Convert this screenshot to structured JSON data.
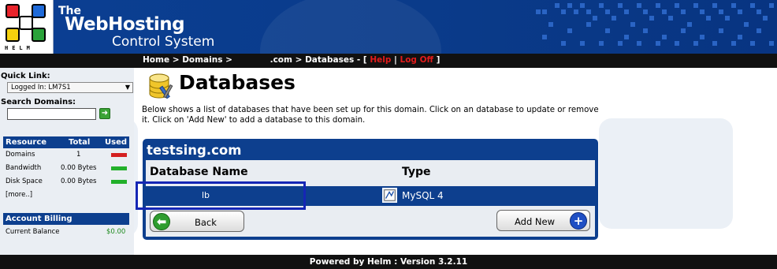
{
  "header": {
    "logo_text": "HELM",
    "brand_line1": "The",
    "brand_line2": "WebHosting",
    "brand_line3": "Control System"
  },
  "breadcrumb": {
    "home": "Home",
    "sep1": " > ",
    "domains": "Domains",
    "sep2": " > ",
    "domain_suffix": ".com",
    "sep3": " > ",
    "databases": "Databases",
    "bracket_open": " - [ ",
    "help": "Help",
    "pipe": " | ",
    "logoff": "Log Off",
    "bracket_close": " ]"
  },
  "sidebar": {
    "quick_link_label": "Quick Link:",
    "quick_link_value": "Logged In: LM7S1",
    "search_label": "Search Domains:",
    "search_value": "",
    "resource_header": {
      "col1": "Resource",
      "col2": "Total",
      "col3": "Used"
    },
    "resources": [
      {
        "name": "Domains",
        "total": "1",
        "used_color": "#d42020"
      },
      {
        "name": "Bandwidth",
        "total": "0.00 Bytes",
        "used_color": "#22b02a"
      },
      {
        "name": "Disk Space",
        "total": "0.00 Bytes",
        "used_color": "#22b02a"
      }
    ],
    "more_link": "[more..]",
    "billing_header": "Account Billing",
    "balance_label": "Current Balance",
    "balance_value": "$0.00"
  },
  "main": {
    "title": "Databases",
    "description": "Below shows a list of databases that have been set up for this domain. Click on an database to update or remove it. Click on 'Add New' to add a database to this domain.",
    "domain": "testsing.com",
    "columns": {
      "name": "Database Name",
      "type": "Type"
    },
    "rows": [
      {
        "name": "lb",
        "type": "MySQL 4",
        "icon": "database-type-icon"
      }
    ],
    "back_label": "Back",
    "add_label": "Add New"
  },
  "footer": {
    "text": "Powered by Helm  :  Version 3.2.11"
  },
  "colors": {
    "brand_blue": "#0d3f8e",
    "bar_black": "#111111",
    "link_red": "#e31b1b",
    "highlight": "#1526b5"
  }
}
